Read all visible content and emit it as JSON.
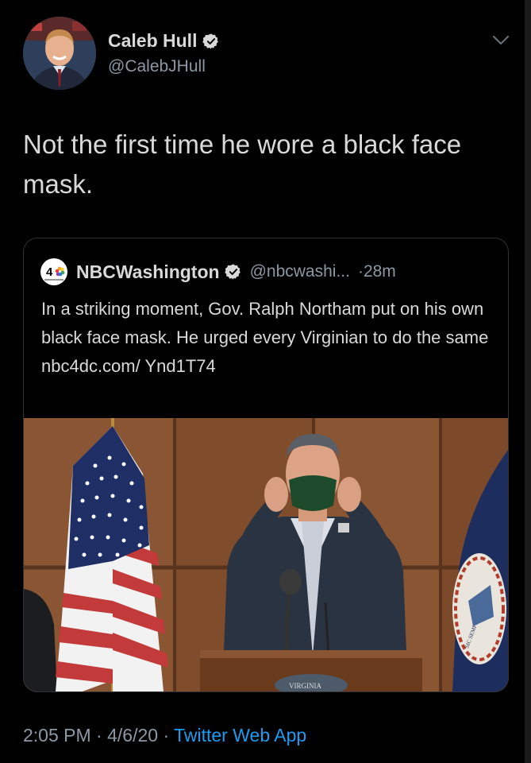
{
  "tweet": {
    "author_name": "Caleb Hull",
    "author_handle": "@CalebJHull",
    "text": "Not the first time he wore a black face mask.",
    "time": "2:05 PM",
    "date": "4/6/20",
    "separator": "·",
    "source": "Twitter Web App"
  },
  "quoted_tweet": {
    "logo_text": "4",
    "author_name": "NBCWashington",
    "author_handle": "@nbcwashi...",
    "age": "·28m",
    "text": "In a striking moment, Gov. Ralph Northam put on his own black face mask. He urged every Virginian to do the same nbc4dc.com/ Ynd1T74",
    "media": {
      "seal_text": "SIC SEMPER TYRANNIS",
      "podium_text": "VIRGINIA"
    }
  },
  "colors": {
    "background": "#000000",
    "text": "#d9d9d9",
    "muted": "#8b98a5",
    "link": "#1d9bf0",
    "border": "#2f3336"
  },
  "icons": [
    "verified-badge-icon",
    "chevron-down-icon",
    "nbc-peacock-logo"
  ]
}
